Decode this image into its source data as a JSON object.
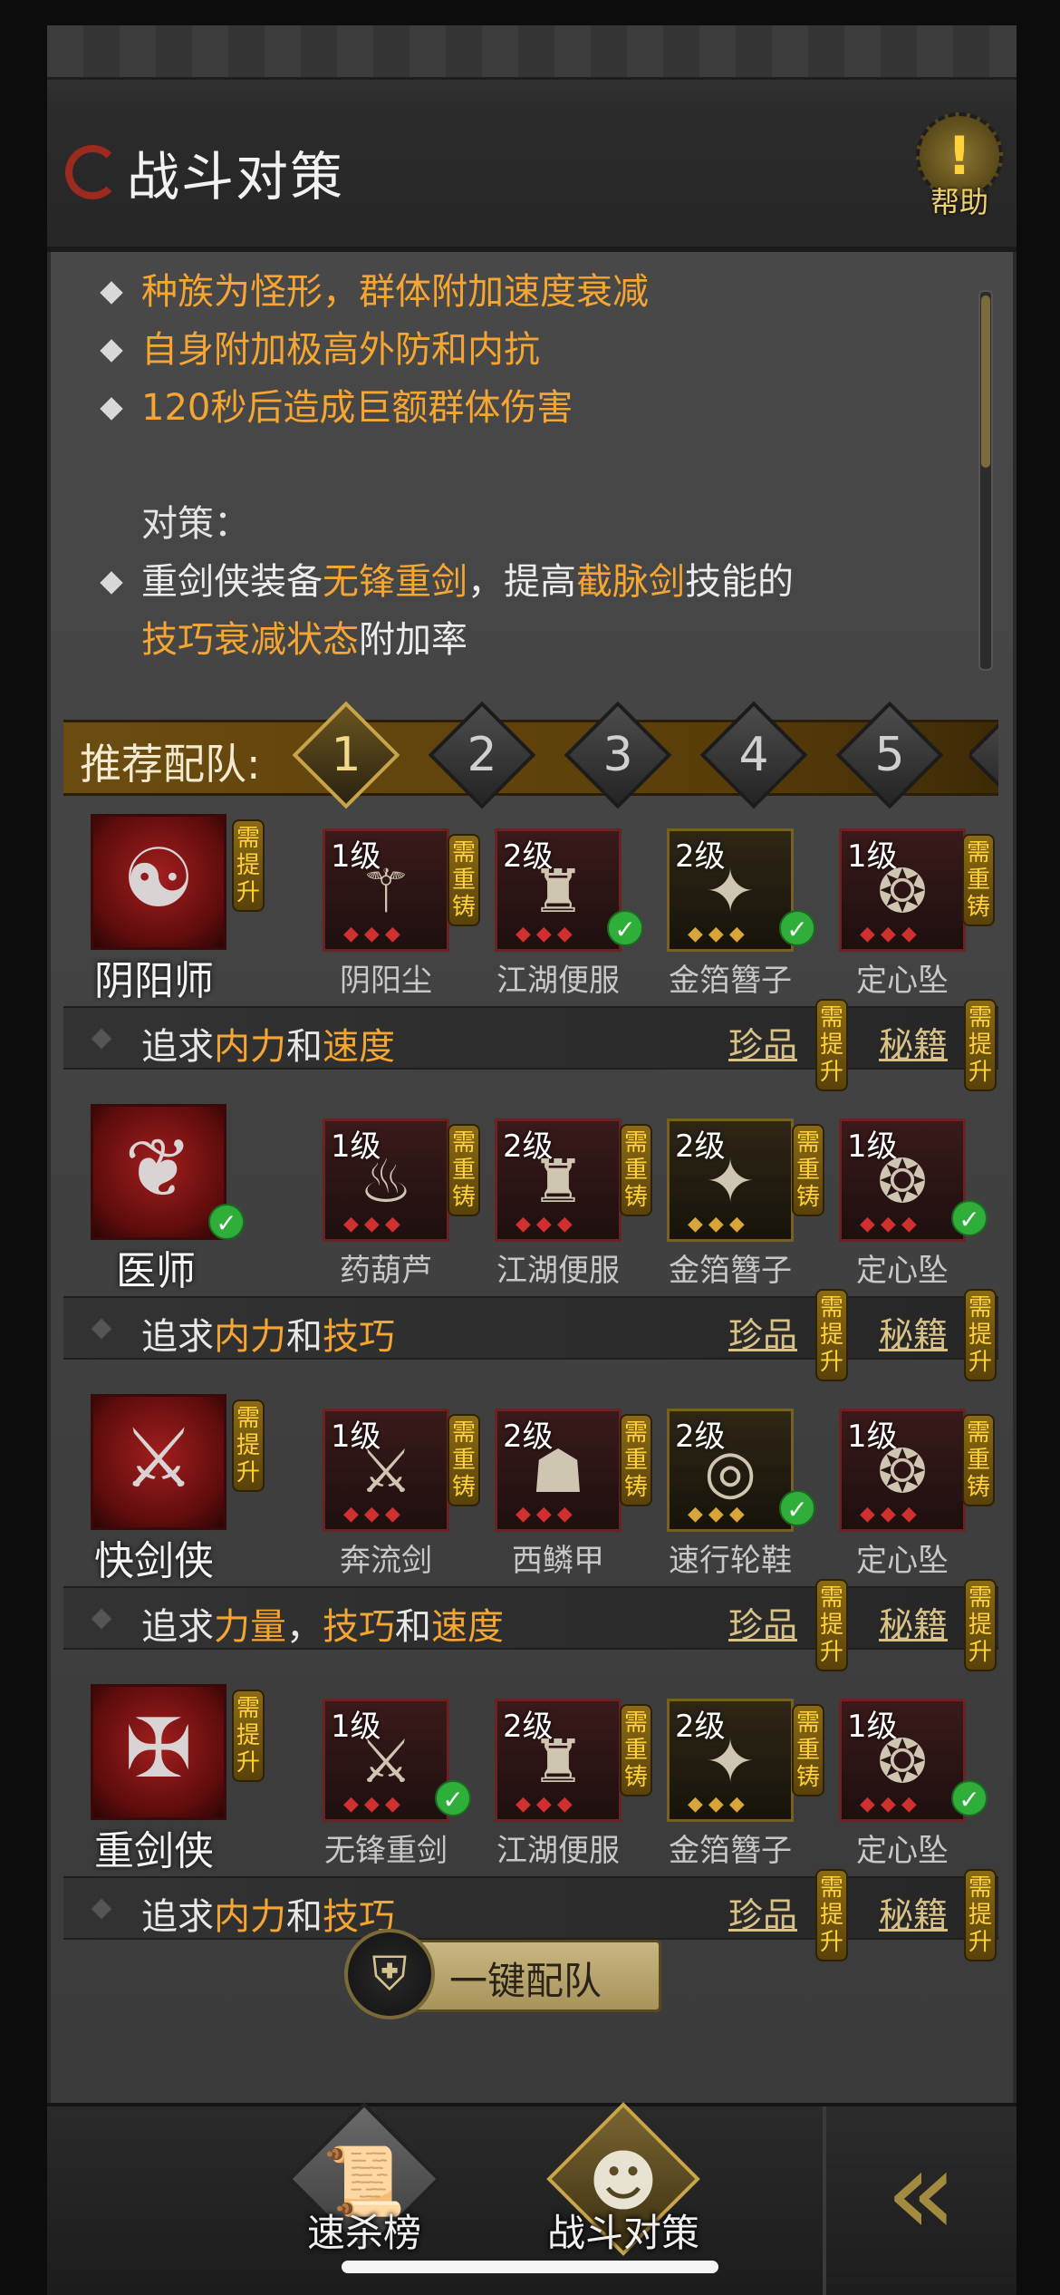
{
  "header": {
    "title": "战斗对策",
    "help_label": "帮助",
    "help_glyph": "!"
  },
  "description": {
    "features": [
      "种族为怪形，群体附加速度衰减",
      "自身附加极高外防和内抗",
      "120秒后造成巨额群体伤害"
    ],
    "strategy_label": "对策：",
    "strategy": {
      "p1": "重剑侠装备",
      "h1": "无锋重剑",
      "p2": "，提高",
      "h2": "截脉剑",
      "p3": "技能的",
      "h3": "技巧衰减状态",
      "p4": "附加率"
    }
  },
  "team": {
    "label": "推荐配队:",
    "tabs": [
      "1",
      "2",
      "3",
      "4",
      "5"
    ],
    "active_tab": "1"
  },
  "need_upgrade_tag": "需提升",
  "need_reforge_tag": "需重铸",
  "treasure_label": "珍品",
  "manual_label": "秘籍",
  "members": [
    {
      "class_name": "阴阳师",
      "class_glyph": "☯",
      "items": [
        {
          "level": "1级",
          "name": "阴阳尘",
          "glyph": "⚚"
        },
        {
          "level": "2级",
          "name": "江湖便服",
          "glyph": "♜"
        },
        {
          "level": "2级",
          "name": "金箔簪子",
          "glyph": "✦"
        },
        {
          "level": "1级",
          "name": "定心坠",
          "glyph": "❂"
        }
      ],
      "pursuit": {
        "prefix": "追求",
        "a": "内力",
        "mid": "和",
        "b": "速度"
      }
    },
    {
      "class_name": "医师",
      "class_glyph": "❦",
      "items": [
        {
          "level": "1级",
          "name": "药葫芦",
          "glyph": "♨"
        },
        {
          "level": "2级",
          "name": "江湖便服",
          "glyph": "♜"
        },
        {
          "level": "2级",
          "name": "金箔簪子",
          "glyph": "✦"
        },
        {
          "level": "1级",
          "name": "定心坠",
          "glyph": "❂"
        }
      ],
      "pursuit": {
        "prefix": "追求",
        "a": "内力",
        "mid": "和",
        "b": "技巧"
      }
    },
    {
      "class_name": "快剑侠",
      "class_glyph": "⚔",
      "items": [
        {
          "level": "1级",
          "name": "奔流剑",
          "glyph": "⚔"
        },
        {
          "level": "2级",
          "name": "西鳞甲",
          "glyph": "☗"
        },
        {
          "level": "2级",
          "name": "速行轮鞋",
          "glyph": "◎"
        },
        {
          "level": "1级",
          "name": "定心坠",
          "glyph": "❂"
        }
      ],
      "pursuit": {
        "prefix": "追求",
        "a": "力量",
        "sep": "，",
        "b": "技巧",
        "mid": "和",
        "c": "速度"
      }
    },
    {
      "class_name": "重剑侠",
      "class_glyph": "✠",
      "items": [
        {
          "level": "1级",
          "name": "无锋重剑",
          "glyph": "⚔"
        },
        {
          "level": "2级",
          "name": "江湖便服",
          "glyph": "♜"
        },
        {
          "level": "2级",
          "name": "金箔簪子",
          "glyph": "✦"
        },
        {
          "level": "1级",
          "name": "定心坠",
          "glyph": "❂"
        }
      ],
      "pursuit": {
        "prefix": "追求",
        "a": "内力",
        "mid": "和",
        "b": "技巧"
      }
    }
  ],
  "one_key_label": "一键配队",
  "bottom_nav": {
    "kill_rank": "速杀榜",
    "battle_strategy": "战斗对策"
  },
  "colors": {
    "highlight": "#f5a531",
    "check": "#2fae3a",
    "tag_gold": "#ffd23a"
  }
}
